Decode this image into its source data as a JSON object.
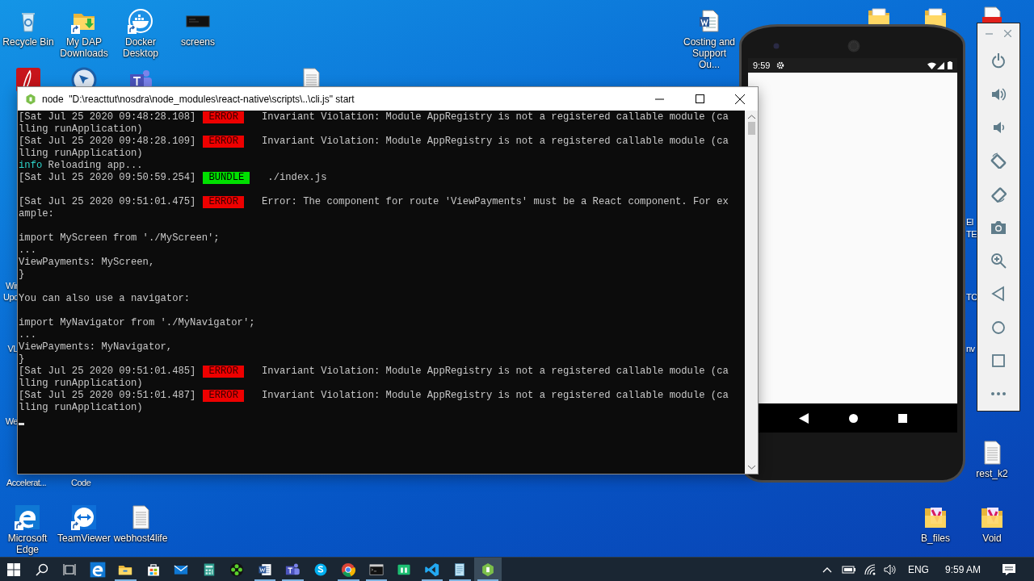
{
  "desktop_icons": [
    {
      "label": "Recycle Bin",
      "kind": "bin",
      "shortcut": false
    },
    {
      "label": "My DAP Downloads",
      "kind": "download-folder",
      "shortcut": true
    },
    {
      "label": "Docker Desktop",
      "kind": "whale",
      "shortcut": true
    },
    {
      "label": "screens",
      "kind": "monitor",
      "shortcut": false
    },
    {
      "label": "Costing and Support Ou...",
      "kind": "word-doc",
      "shortcut": false
    },
    {
      "label": "Microsoft Edge",
      "kind": "edge",
      "shortcut": true
    },
    {
      "label": "TeamViewer",
      "kind": "teamviewer",
      "shortcut": true
    },
    {
      "label": "webhost4life",
      "kind": "file",
      "shortcut": false
    },
    {
      "label": "rest_k2",
      "kind": "file",
      "shortcut": false
    },
    {
      "label": "B_files",
      "kind": "color-folder",
      "shortcut": false
    },
    {
      "label": "Void",
      "kind": "color-folder",
      "shortcut": false
    }
  ],
  "covered_icons": [
    {
      "kind": "acrobat"
    },
    {
      "kind": "blue-circle"
    },
    {
      "kind": "teams"
    },
    {
      "kind": "file"
    },
    {
      "kind": "doc-folder"
    },
    {
      "kind": "doc-folder"
    },
    {
      "kind": "pdf"
    }
  ],
  "partial_labels": [
    "Wir",
    "Upc",
    "VL",
    "We",
    "Accelerat...",
    "Code",
    "El",
    "TE",
    "TC",
    "nv"
  ],
  "terminal": {
    "title": "node  \"D:\\reacttut\\nosdra\\node_modules\\react-native\\scripts\\..\\cli.js\" start",
    "lines": [
      {
        "kind": "error",
        "timestamp": "[Sat Jul 25 2020 09:48:28.108]",
        "tag": "ERROR",
        "text": "Invariant Violation: Module AppRegistry is not a registered callable module (ca"
      },
      {
        "kind": "text",
        "text": "lling runApplication)"
      },
      {
        "kind": "error",
        "timestamp": "[Sat Jul 25 2020 09:48:28.109]",
        "tag": "ERROR",
        "text": "Invariant Violation: Module AppRegistry is not a registered callable module (ca"
      },
      {
        "kind": "text",
        "text": "lling runApplication)"
      },
      {
        "kind": "info",
        "label": "info",
        "text": "Reloading app..."
      },
      {
        "kind": "bundle",
        "timestamp": "[Sat Jul 25 2020 09:50:59.254]",
        "tag": "BUNDLE",
        "text": "./index.js"
      },
      {
        "kind": "blank"
      },
      {
        "kind": "error",
        "timestamp": "[Sat Jul 25 2020 09:51:01.475]",
        "tag": "ERROR",
        "text": "Error: The component for route 'ViewPayments' must be a React component. For ex"
      },
      {
        "kind": "text",
        "text": "ample:"
      },
      {
        "kind": "blank"
      },
      {
        "kind": "text",
        "text": "import MyScreen from './MyScreen';"
      },
      {
        "kind": "text",
        "text": "..."
      },
      {
        "kind": "text",
        "text": "ViewPayments: MyScreen,"
      },
      {
        "kind": "text",
        "text": "}"
      },
      {
        "kind": "blank"
      },
      {
        "kind": "text",
        "text": "You can also use a navigator:"
      },
      {
        "kind": "blank"
      },
      {
        "kind": "text",
        "text": "import MyNavigator from './MyNavigator';"
      },
      {
        "kind": "text",
        "text": "..."
      },
      {
        "kind": "text",
        "text": "ViewPayments: MyNavigator,"
      },
      {
        "kind": "text",
        "text": "}"
      },
      {
        "kind": "error",
        "timestamp": "[Sat Jul 25 2020 09:51:01.485]",
        "tag": "ERROR",
        "text": "Invariant Violation: Module AppRegistry is not a registered callable module (ca"
      },
      {
        "kind": "text",
        "text": "lling runApplication)"
      },
      {
        "kind": "error",
        "timestamp": "[Sat Jul 25 2020 09:51:01.487]",
        "tag": "ERROR",
        "text": "Invariant Violation: Module AppRegistry is not a registered callable module (ca"
      },
      {
        "kind": "text",
        "text": "lling runApplication)"
      },
      {
        "kind": "cursor"
      }
    ]
  },
  "phone": {
    "time": "9:59"
  },
  "emulator_toolbar": {
    "buttons": [
      {
        "kind": "power"
      },
      {
        "kind": "volume-up"
      },
      {
        "kind": "volume-down"
      },
      {
        "kind": "rotate-left"
      },
      {
        "kind": "rotate-right"
      },
      {
        "kind": "camera"
      },
      {
        "kind": "zoom"
      },
      {
        "kind": "back"
      },
      {
        "kind": "home"
      },
      {
        "kind": "overview"
      },
      {
        "kind": "more"
      }
    ]
  },
  "taskbar": {
    "apps": [
      {
        "kind": "edge",
        "running": false,
        "selected": false
      },
      {
        "kind": "explorer",
        "running": true,
        "selected": false
      },
      {
        "kind": "store",
        "running": false,
        "selected": false
      },
      {
        "kind": "mail",
        "running": false,
        "selected": false
      },
      {
        "kind": "calculator",
        "running": false,
        "selected": false
      },
      {
        "kind": "gamepad",
        "running": false,
        "selected": false
      },
      {
        "kind": "word",
        "running": true,
        "selected": false
      },
      {
        "kind": "teams",
        "running": true,
        "selected": false
      },
      {
        "kind": "skype",
        "running": false,
        "selected": false
      },
      {
        "kind": "chrome",
        "running": true,
        "selected": false
      },
      {
        "kind": "terminal",
        "running": true,
        "selected": false
      },
      {
        "kind": "green-app",
        "running": false,
        "selected": false
      },
      {
        "kind": "vscode",
        "running": true,
        "selected": false
      },
      {
        "kind": "notepad",
        "running": true,
        "selected": false
      },
      {
        "kind": "node",
        "running": true,
        "selected": true
      }
    ],
    "language": "ENG",
    "clock": "9:59 AM"
  }
}
